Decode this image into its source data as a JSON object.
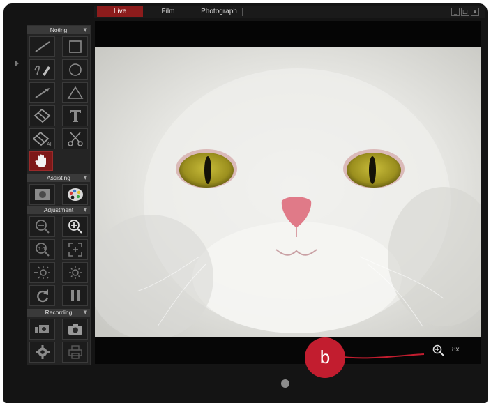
{
  "tabs": [
    {
      "label": "Live",
      "active": true
    },
    {
      "label": "Film",
      "active": false
    },
    {
      "label": "Photograph",
      "active": false
    }
  ],
  "window_controls": [
    "_",
    "□",
    "x"
  ],
  "sections": {
    "noting": "Noting",
    "assisting": "Assisting",
    "adjustment": "Adjustment",
    "recording": "Recording"
  },
  "tools": {
    "noting": [
      "line-icon",
      "rectangle-icon",
      "freehand-pencil-icon",
      "circle-icon",
      "arrow-line-icon",
      "triangle-icon",
      "eraser-icon",
      "text-icon",
      "clear-all-icon",
      "scissors-icon",
      "hand-pan-icon"
    ],
    "assisting": [
      "display-icon",
      "color-palette-icon"
    ],
    "adjustment": [
      "zoom-out-icon",
      "zoom-in-icon",
      "actual-size-icon",
      "fit-screen-icon",
      "brightness-down-icon",
      "brightness-up-icon",
      "rotate-icon",
      "pause-icon"
    ],
    "recording": [
      "video-camera-icon",
      "camera-icon",
      "settings-gear-icon",
      "printer-icon"
    ]
  },
  "zoom": {
    "level": "8x"
  },
  "callout": {
    "label": "b"
  },
  "colors": {
    "accent": "#8c1c1c",
    "callout": "#c21d2f"
  }
}
